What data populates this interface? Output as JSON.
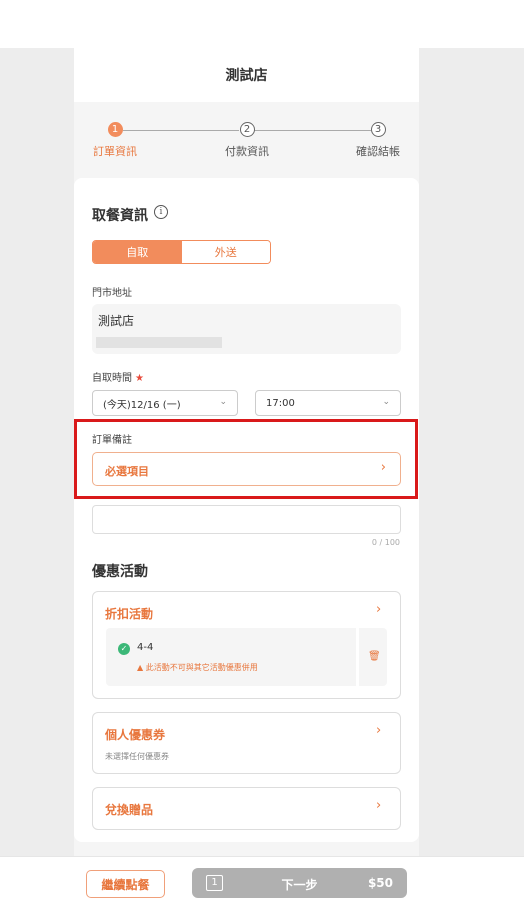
{
  "header": {
    "store_name": "測試店"
  },
  "steps": [
    {
      "number": "1",
      "label": "訂單資訊",
      "active": true
    },
    {
      "number": "2",
      "label": "付款資訊",
      "active": false
    },
    {
      "number": "3",
      "label": "確認結帳",
      "active": false
    }
  ],
  "pickup": {
    "title": "取餐資訊",
    "info_icon": "i",
    "tabs": [
      {
        "label": "自取",
        "selected": true
      },
      {
        "label": "外送",
        "selected": false
      }
    ],
    "address_label": "門市地址",
    "store_name": "測試店",
    "time_label": "自取時間",
    "required_mark": "★",
    "date_value": "(今天)12/16 (一)",
    "time_value": "17:00",
    "dropdown_icon": "chevron-down-icon"
  },
  "order_note": {
    "label": "訂單備註",
    "required_button_label": "必選項目",
    "textarea_value": "",
    "counter": "0 / 100"
  },
  "promotions": {
    "title": "優惠活動",
    "discount": {
      "title": "折扣活動",
      "item_name": "4-4",
      "warning": "此活動不可與其它活動優惠併用"
    },
    "coupon": {
      "title": "個人優惠券",
      "subtitle": "未選擇任何優惠券"
    },
    "gift": {
      "title": "兌換贈品"
    }
  },
  "footer": {
    "continue_label": "繼續點餐",
    "quantity": "1",
    "next_label": "下一步",
    "total": "$50"
  },
  "colors": {
    "accent": "#f28c5c",
    "accent_text": "#e8773e",
    "highlight": "#d9191a",
    "success": "#3cb878",
    "disabled": "#b0b0b0"
  }
}
